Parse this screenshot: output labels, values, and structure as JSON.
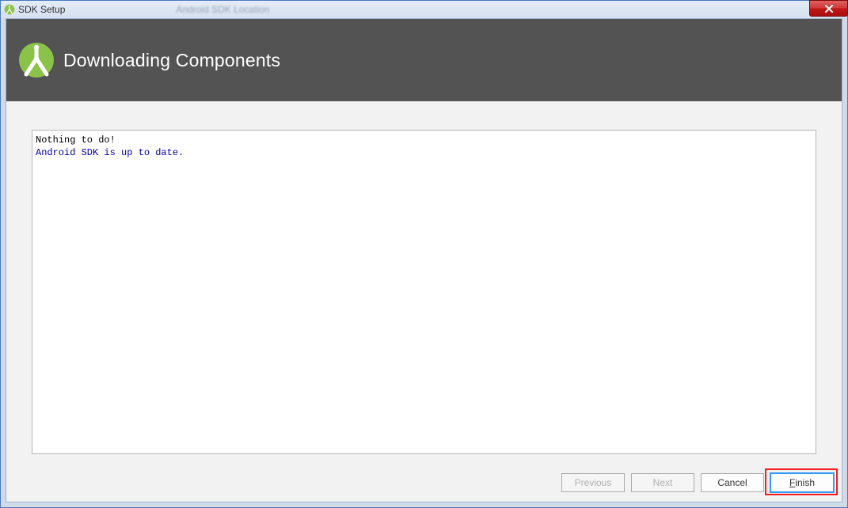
{
  "window": {
    "title": "SDK Setup",
    "background_hint": "Android SDK Location"
  },
  "header": {
    "heading": "Downloading Components"
  },
  "log": {
    "line1": "Nothing to do!",
    "line2": "Android SDK is up to date."
  },
  "buttons": {
    "previous": "Previous",
    "next": "Next",
    "cancel": "Cancel",
    "finish_prefix": "F",
    "finish_rest": "inish"
  }
}
